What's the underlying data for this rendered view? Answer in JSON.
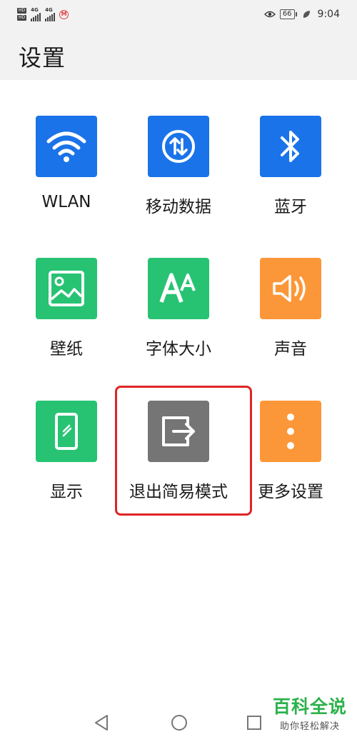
{
  "status_bar": {
    "network_left": "4G",
    "network_right": "4G",
    "sim_badge": "M",
    "battery": "66",
    "time": "9:04"
  },
  "header": {
    "title": "设置"
  },
  "tiles": [
    {
      "label": "WLAN",
      "icon": "wifi-icon",
      "color": "#1a73e8"
    },
    {
      "label": "移动数据",
      "icon": "mobile-data-icon",
      "color": "#1a73e8"
    },
    {
      "label": "蓝牙",
      "icon": "bluetooth-icon",
      "color": "#1a73e8"
    },
    {
      "label": "壁纸",
      "icon": "wallpaper-icon",
      "color": "#27c373"
    },
    {
      "label": "字体大小",
      "icon": "font-size-icon",
      "color": "#27c373"
    },
    {
      "label": "声音",
      "icon": "sound-icon",
      "color": "#fb9738"
    },
    {
      "label": "显示",
      "icon": "display-icon",
      "color": "#27c373"
    },
    {
      "label": "退出简易模式",
      "icon": "exit-simple-mode-icon",
      "color": "#757575"
    },
    {
      "label": "更多设置",
      "icon": "more-icon",
      "color": "#fb9738"
    }
  ],
  "highlight_color": "#e02424",
  "watermark": {
    "title": "百科全说",
    "subtitle": "助你轻松解决"
  }
}
